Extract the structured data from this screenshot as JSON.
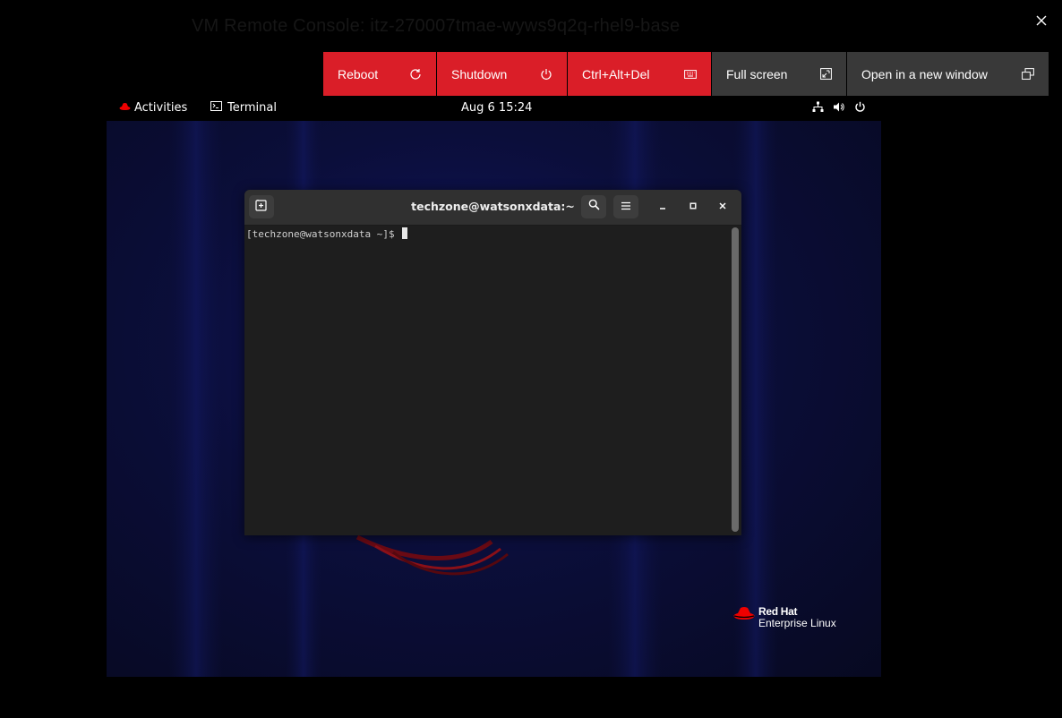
{
  "modal": {
    "title": "VM Remote Console: itz-270007tmae-wyws9q2q-rhel9-base"
  },
  "toolbar": {
    "reboot_label": "Reboot",
    "shutdown_label": "Shutdown",
    "ctrl_alt_del_label": "Ctrl+Alt+Del",
    "fullscreen_label": "Full screen",
    "new_window_label": "Open in a new window",
    "danger_color": "#da1e28",
    "neutral_color": "#393939"
  },
  "gnome": {
    "activities_label": "Activities",
    "app_label": "Terminal",
    "clock": "Aug 6  15:24",
    "icons": [
      "network-icon",
      "volume-icon",
      "power-icon"
    ]
  },
  "terminal": {
    "title": "techzone@watsonxdata:~",
    "prompt": "[techzone@watsonxdata ~]$ "
  },
  "branding": {
    "brand": "Red Hat",
    "product": "Enterprise Linux"
  }
}
